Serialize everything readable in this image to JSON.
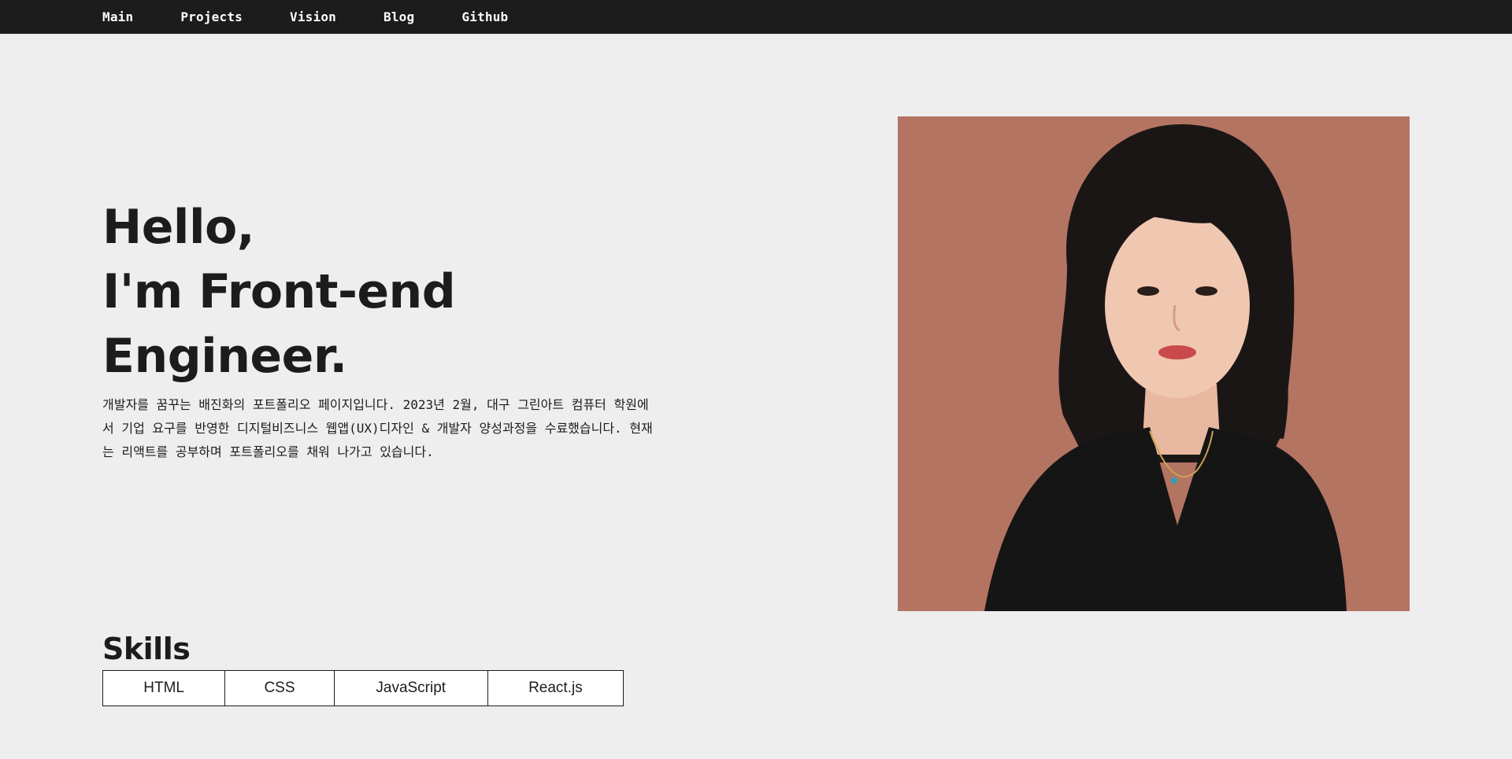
{
  "nav": {
    "items": [
      {
        "label": "Main"
      },
      {
        "label": "Projects"
      },
      {
        "label": "Vision"
      },
      {
        "label": "Blog"
      },
      {
        "label": "Github"
      }
    ]
  },
  "hero": {
    "title_line1": "Hello,",
    "title_line2": "I'm Front-end Engineer.",
    "description": "개발자를 꿈꾸는 배진화의 포트폴리오 페이지입니다. 2023년 2월, 대구 그린아트 컴퓨터 학원에서 기업 요구를 반영한 디지털비즈니스 웹앱(UX)디자인 & 개발자 양성과정을 수료했습니다. 현재는 리액트를 공부하며 포트폴리오를 채워 나가고 있습니다."
  },
  "skills": {
    "title": "Skills",
    "items": [
      "HTML",
      "CSS",
      "JavaScript",
      "React.js"
    ]
  },
  "colors": {
    "nav_bg": "#1c1c1c",
    "page_bg": "#eeeeee",
    "photo_bg": "#b47462"
  }
}
